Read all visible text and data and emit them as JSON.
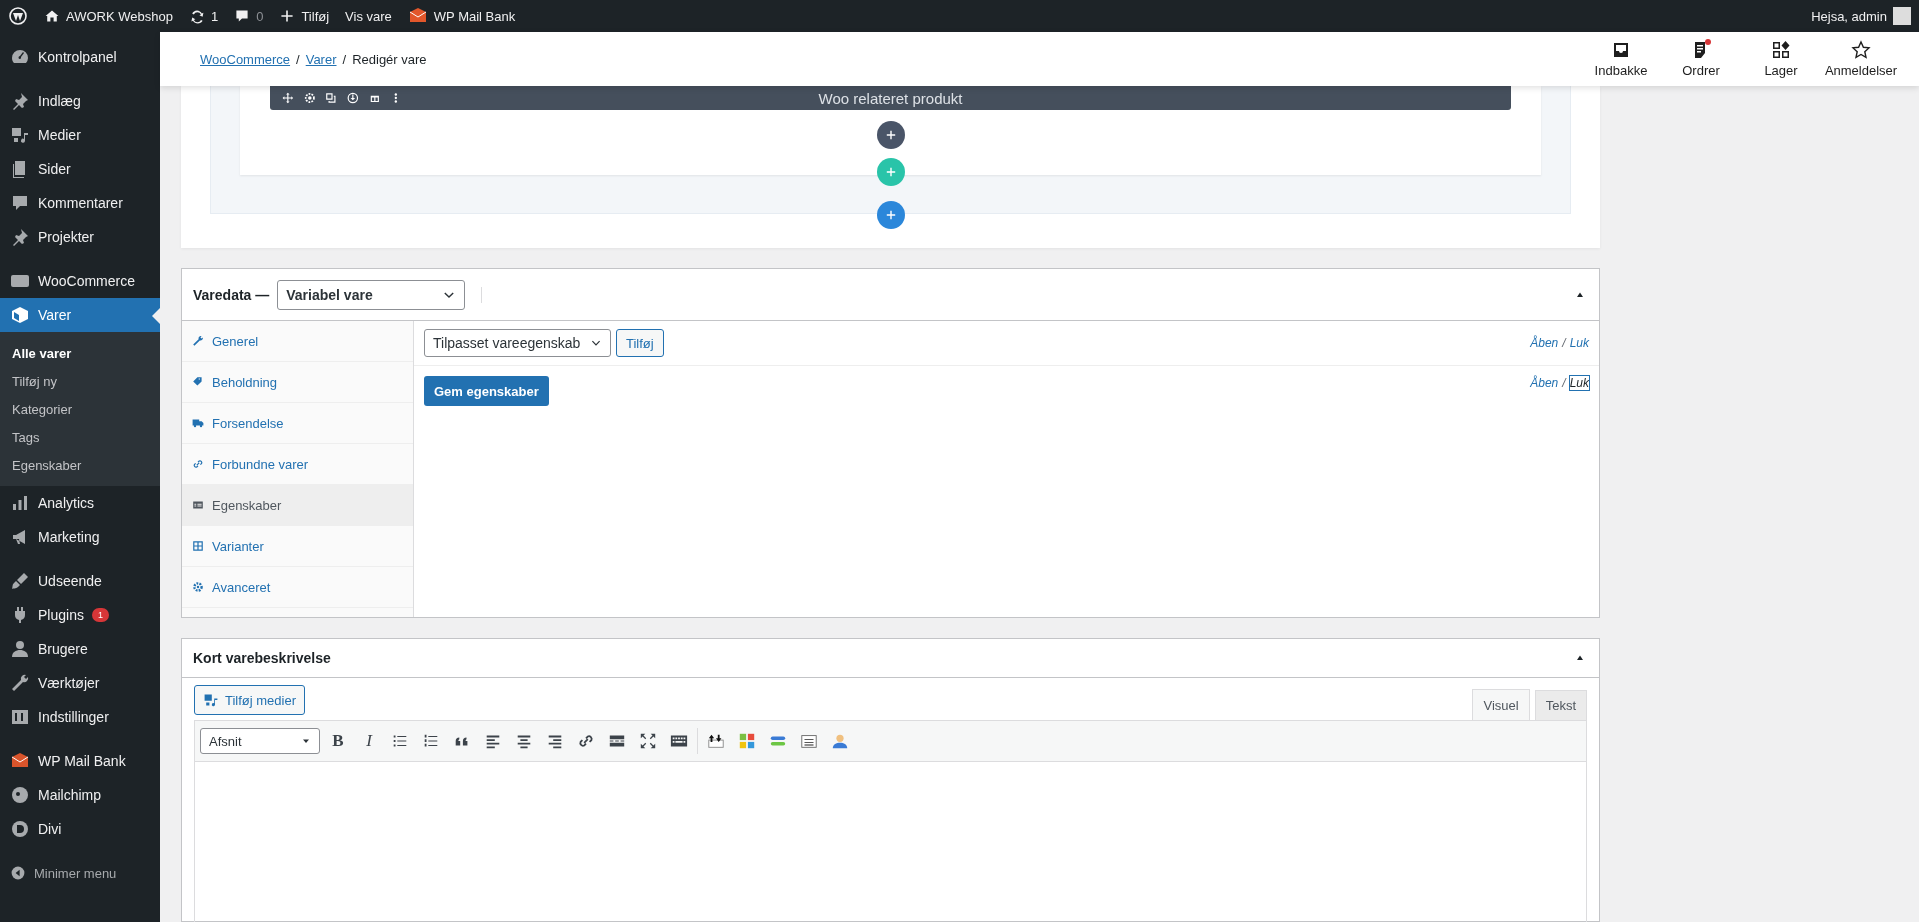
{
  "admin_bar": {
    "site": "AWORK Webshop",
    "updates": "1",
    "comments": "0",
    "new": "Tilføj",
    "view": "Vis vare",
    "plugin": "WP Mail Bank",
    "greeting": "Hejsa, admin"
  },
  "sidebar": {
    "groups": [
      [
        {
          "label": "Kontrolpanel",
          "selected": false
        }
      ],
      [
        {
          "label": "Indlæg",
          "selected": false
        },
        {
          "label": "Medier",
          "selected": false
        },
        {
          "label": "Sider",
          "selected": false
        },
        {
          "label": "Kommentarer",
          "selected": false
        },
        {
          "label": "Projekter",
          "selected": false
        }
      ],
      [
        {
          "label": "WooCommerce",
          "selected": false
        },
        {
          "label": "Varer",
          "selected": true,
          "submenu": [
            {
              "label": "Alle varer",
              "selected": true
            },
            {
              "label": "Tilføj ny",
              "selected": false
            },
            {
              "label": "Kategorier",
              "selected": false
            },
            {
              "label": "Tags",
              "selected": false
            },
            {
              "label": "Egenskaber",
              "selected": false
            }
          ]
        },
        {
          "label": "Analytics",
          "selected": false
        },
        {
          "label": "Marketing",
          "selected": false
        }
      ],
      [
        {
          "label": "Udseende",
          "selected": false
        },
        {
          "label": "Plugins",
          "selected": false,
          "badge": "1"
        },
        {
          "label": "Brugere",
          "selected": false
        },
        {
          "label": "Værktøjer",
          "selected": false
        },
        {
          "label": "Indstillinger",
          "selected": false
        }
      ],
      [
        {
          "label": "WP Mail Bank",
          "selected": false
        },
        {
          "label": "Mailchimp",
          "selected": false
        },
        {
          "label": "Divi",
          "selected": false
        }
      ]
    ],
    "collapse": "Minimer menu"
  },
  "header": {
    "breadcrumbs": [
      {
        "label": "WooCommerce",
        "link": true
      },
      {
        "separator": "/",
        "label": "Varer",
        "link": true
      },
      {
        "separator": "/",
        "label": "Redigér vare",
        "link": false
      }
    ],
    "actions": [
      {
        "label": "Indbakke",
        "notification": false
      },
      {
        "label": "Ordrer",
        "notification": true
      },
      {
        "label": "Lager",
        "notification": false
      },
      {
        "label": "Anmeldelser",
        "notification": false
      }
    ]
  },
  "builder": {
    "module_title": "Woo relateret produkt"
  },
  "product_data": {
    "title": "Varedata —",
    "type": "Variabel vare",
    "tabs": [
      {
        "label": "Generel",
        "selected": false
      },
      {
        "label": "Beholdning",
        "selected": false
      },
      {
        "label": "Forsendelse",
        "selected": false
      },
      {
        "label": "Forbundne varer",
        "selected": false
      },
      {
        "label": "Egenskaber",
        "selected": true
      },
      {
        "label": "Varianter",
        "selected": false
      },
      {
        "label": "Avanceret",
        "selected": false
      }
    ],
    "attribute_select": "Tilpasset vareegenskab",
    "add_button": "Tilføj",
    "save_button": "Gem egenskaber",
    "toggles": [
      {
        "expand": "Åben",
        "separator": "/",
        "collapse": "Luk",
        "focused": false
      },
      {
        "expand": "Åben",
        "separator": "/",
        "collapse": "Luk",
        "focused": true
      }
    ]
  },
  "short_description": {
    "title": "Kort varebeskrivelse",
    "add_media": "Tilføj medier",
    "format": "Afsnit",
    "text_buttons": [
      "B",
      "I"
    ],
    "tabs": [
      {
        "label": "Visuel",
        "selected": true
      },
      {
        "label": "Tekst",
        "selected": false
      }
    ]
  }
}
